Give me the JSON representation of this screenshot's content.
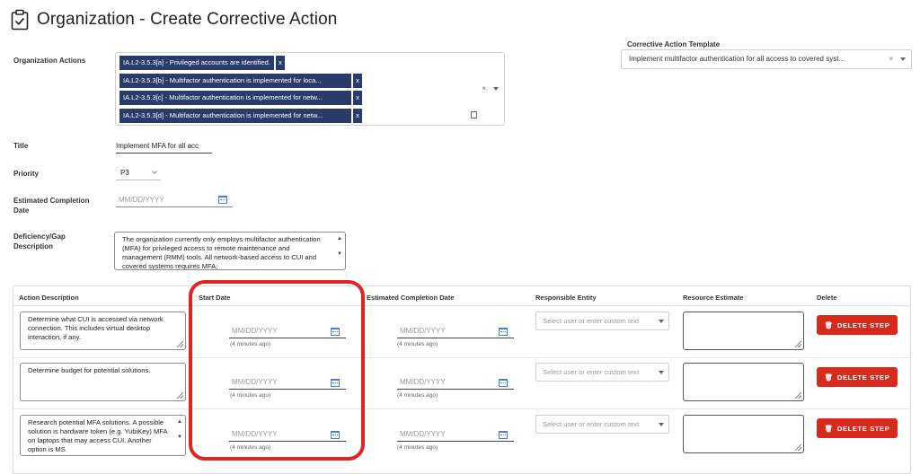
{
  "page": {
    "title": "Organization - Create Corrective Action",
    "title_icon": "clipboard-check-icon"
  },
  "organization_actions": {
    "label": "Organization Actions",
    "tags": [
      "IA.L2-3.5.3[a] - Privileged accounts are identified.",
      "IA.L2-3.5.3[b] - Multifactor authentication is implemented for loca...",
      "IA.L2-3.5.3[c] - Multifactor authentication is implemented for netw...",
      "IA.L2-3.5.3[d] - Multifactor authentication is implemented for netw..."
    ],
    "tag_remove": "x",
    "clear": "×"
  },
  "template": {
    "label": "Corrective Action Template",
    "value": "Implement multifactor authentication for all access to covered syst...",
    "clear": "×"
  },
  "title_field": {
    "label": "Title",
    "value": "Implement MFA for all acc"
  },
  "priority": {
    "label": "Priority",
    "value": "P3"
  },
  "est_completion": {
    "label_line1": "Estimated Completion",
    "label_line2": "Date",
    "placeholder": "MM/DD/YYYY"
  },
  "deficiency": {
    "label_line1": "Deficiency/Gap",
    "label_line2": "Description",
    "text": "The organization currently only employs multifactor authentication (MFA) for privileged access to remote maintenance and management (RMM) tools.  All network-based access to CUI and covered systems requires MFA;"
  },
  "steps": {
    "headers": {
      "action": "Action Description",
      "start": "Start Date",
      "est": "Estimated Completion Date",
      "entity": "Responsible Entity",
      "resource": "Resource Estimate",
      "delete": "Delete"
    },
    "date_placeholder": "MM/DD/YYYY",
    "entity_placeholder": "Select user or enter custom text",
    "delete_label": "DELETE STEP",
    "rows": [
      {
        "action": "Determine what CUI is accessed via network connection.  This includes virtual desktop interaction, if any.",
        "start_ago": "(4 minutes ago)",
        "est_ago": "(4 minutes ago)"
      },
      {
        "action": "Determine budget for potential solutions.",
        "start_ago": "(4 minutes ago)",
        "est_ago": "(4 minutes ago)"
      },
      {
        "action": "Research potential MFA solutions.  A possible solution is hardware token (e.g. YubiKey) MFA on laptops that may access CUI.  Another option is MS",
        "start_ago": "(4 minutes ago)",
        "est_ago": "(4 minutes ago)"
      }
    ]
  },
  "colors": {
    "tag": "#283b6b",
    "delete": "#d72a1c",
    "highlight": "#e02424",
    "calendar": "#4a7fd0"
  }
}
